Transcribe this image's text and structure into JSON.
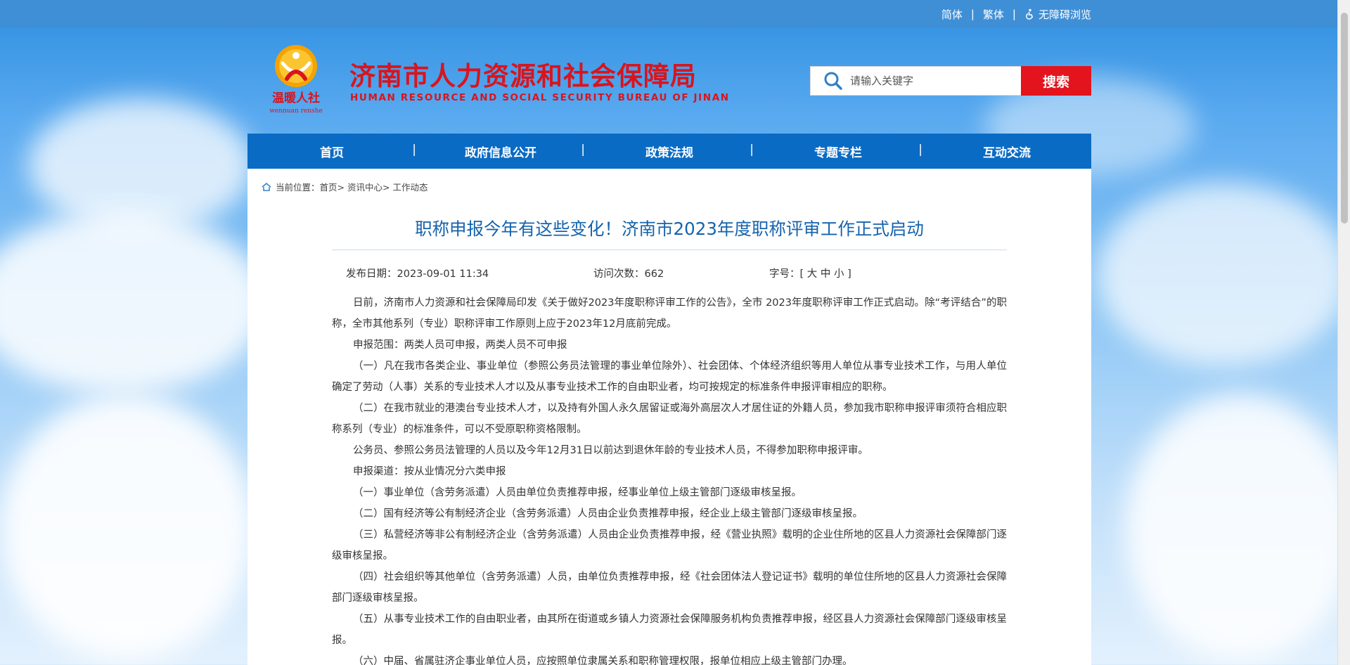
{
  "topbar": {
    "simplified": "简体",
    "separator": "|",
    "traditional": "繁体",
    "accessibility": "无障碍浏览"
  },
  "header": {
    "logo_text": "温暖人社",
    "logo_pinyin": "wennuan renshe",
    "title": "济南市人力资源和社会保障局",
    "subtitle": "HUMAN RESOURCE AND SOCIAL SECURITY BUREAU OF JINAN",
    "search_placeholder": "请输入关键字",
    "search_button": "搜索"
  },
  "nav": [
    "首页",
    "政府信息公开",
    "政策法规",
    "专题专栏",
    "互动交流"
  ],
  "breadcrumb": {
    "prefix": "当前位置：",
    "items": [
      "首页>",
      "资讯中心>",
      "工作动态"
    ]
  },
  "article": {
    "title": "职称申报今年有这些变化！济南市2023年度职称评审工作正式启动",
    "publish_label": "发布日期：2023-09-01 11:34",
    "visits_label": "访问次数：662",
    "font_label": "字号：[",
    "font_large": "大",
    "font_medium": "中",
    "font_small": "小",
    "font_close": "]",
    "paragraphs": [
      "日前，济南市人力资源和社会保障局印发《关于做好2023年度职称评审工作的公告》，全市 2023年度职称评审工作正式启动。除“考评结合”的职称，全市其他系列（专业）职称评审工作原则上应于2023年12月底前完成。",
      "申报范围：两类人员可申报，两类人员不可申报",
      "（一）凡在我市各类企业、事业单位（参照公务员法管理的事业单位除外）、社会团体、个体经济组织等用人单位从事专业技术工作，与用人单位确定了劳动（人事）关系的专业技术人才以及从事专业技术工作的自由职业者，均可按规定的标准条件申报评审相应的职称。",
      "（二）在我市就业的港澳台专业技术人才，以及持有外国人永久居留证或海外高层次人才居住证的外籍人员，参加我市职称申报评审须符合相应职称系列（专业）的标准条件，可以不受原职称资格限制。",
      "公务员、参照公务员法管理的人员以及今年12月31日以前达到退休年龄的专业技术人员，不得参加职称申报评审。",
      "申报渠道：按从业情况分六类申报",
      "（一）事业单位（含劳务派遣）人员由单位负责推荐申报，经事业单位上级主管部门逐级审核呈报。",
      "（二）国有经济等公有制经济企业（含劳务派遣）人员由企业负责推荐申报，经企业上级主管部门逐级审核呈报。",
      "（三）私营经济等非公有制经济企业（含劳务派遣）人员由企业负责推荐申报，经《营业执照》载明的企业住所地的区县人力资源社会保障部门逐级审核呈报。",
      "（四）社会组织等其他单位（含劳务派遣）人员，由单位负责推荐申报，经《社会团体法人登记证书》载明的单位住所地的区县人力资源社会保障部门逐级审核呈报。",
      "（五）从事专业技术工作的自由职业者，由其所在街道或乡镇人力资源社会保障服务机构负责推荐申报，经区县人力资源社会保障部门逐级审核呈报。",
      "（六）中届、省属驻济企事业单位人员，应按照单位隶属关系和职称管理权限，报单位相应上级主管部门办理。"
    ]
  },
  "colors": {
    "topbar": "#3f8fd6",
    "nav": "#0a6bc4",
    "brand_red": "#d9141d",
    "title_blue": "#1563ad"
  }
}
